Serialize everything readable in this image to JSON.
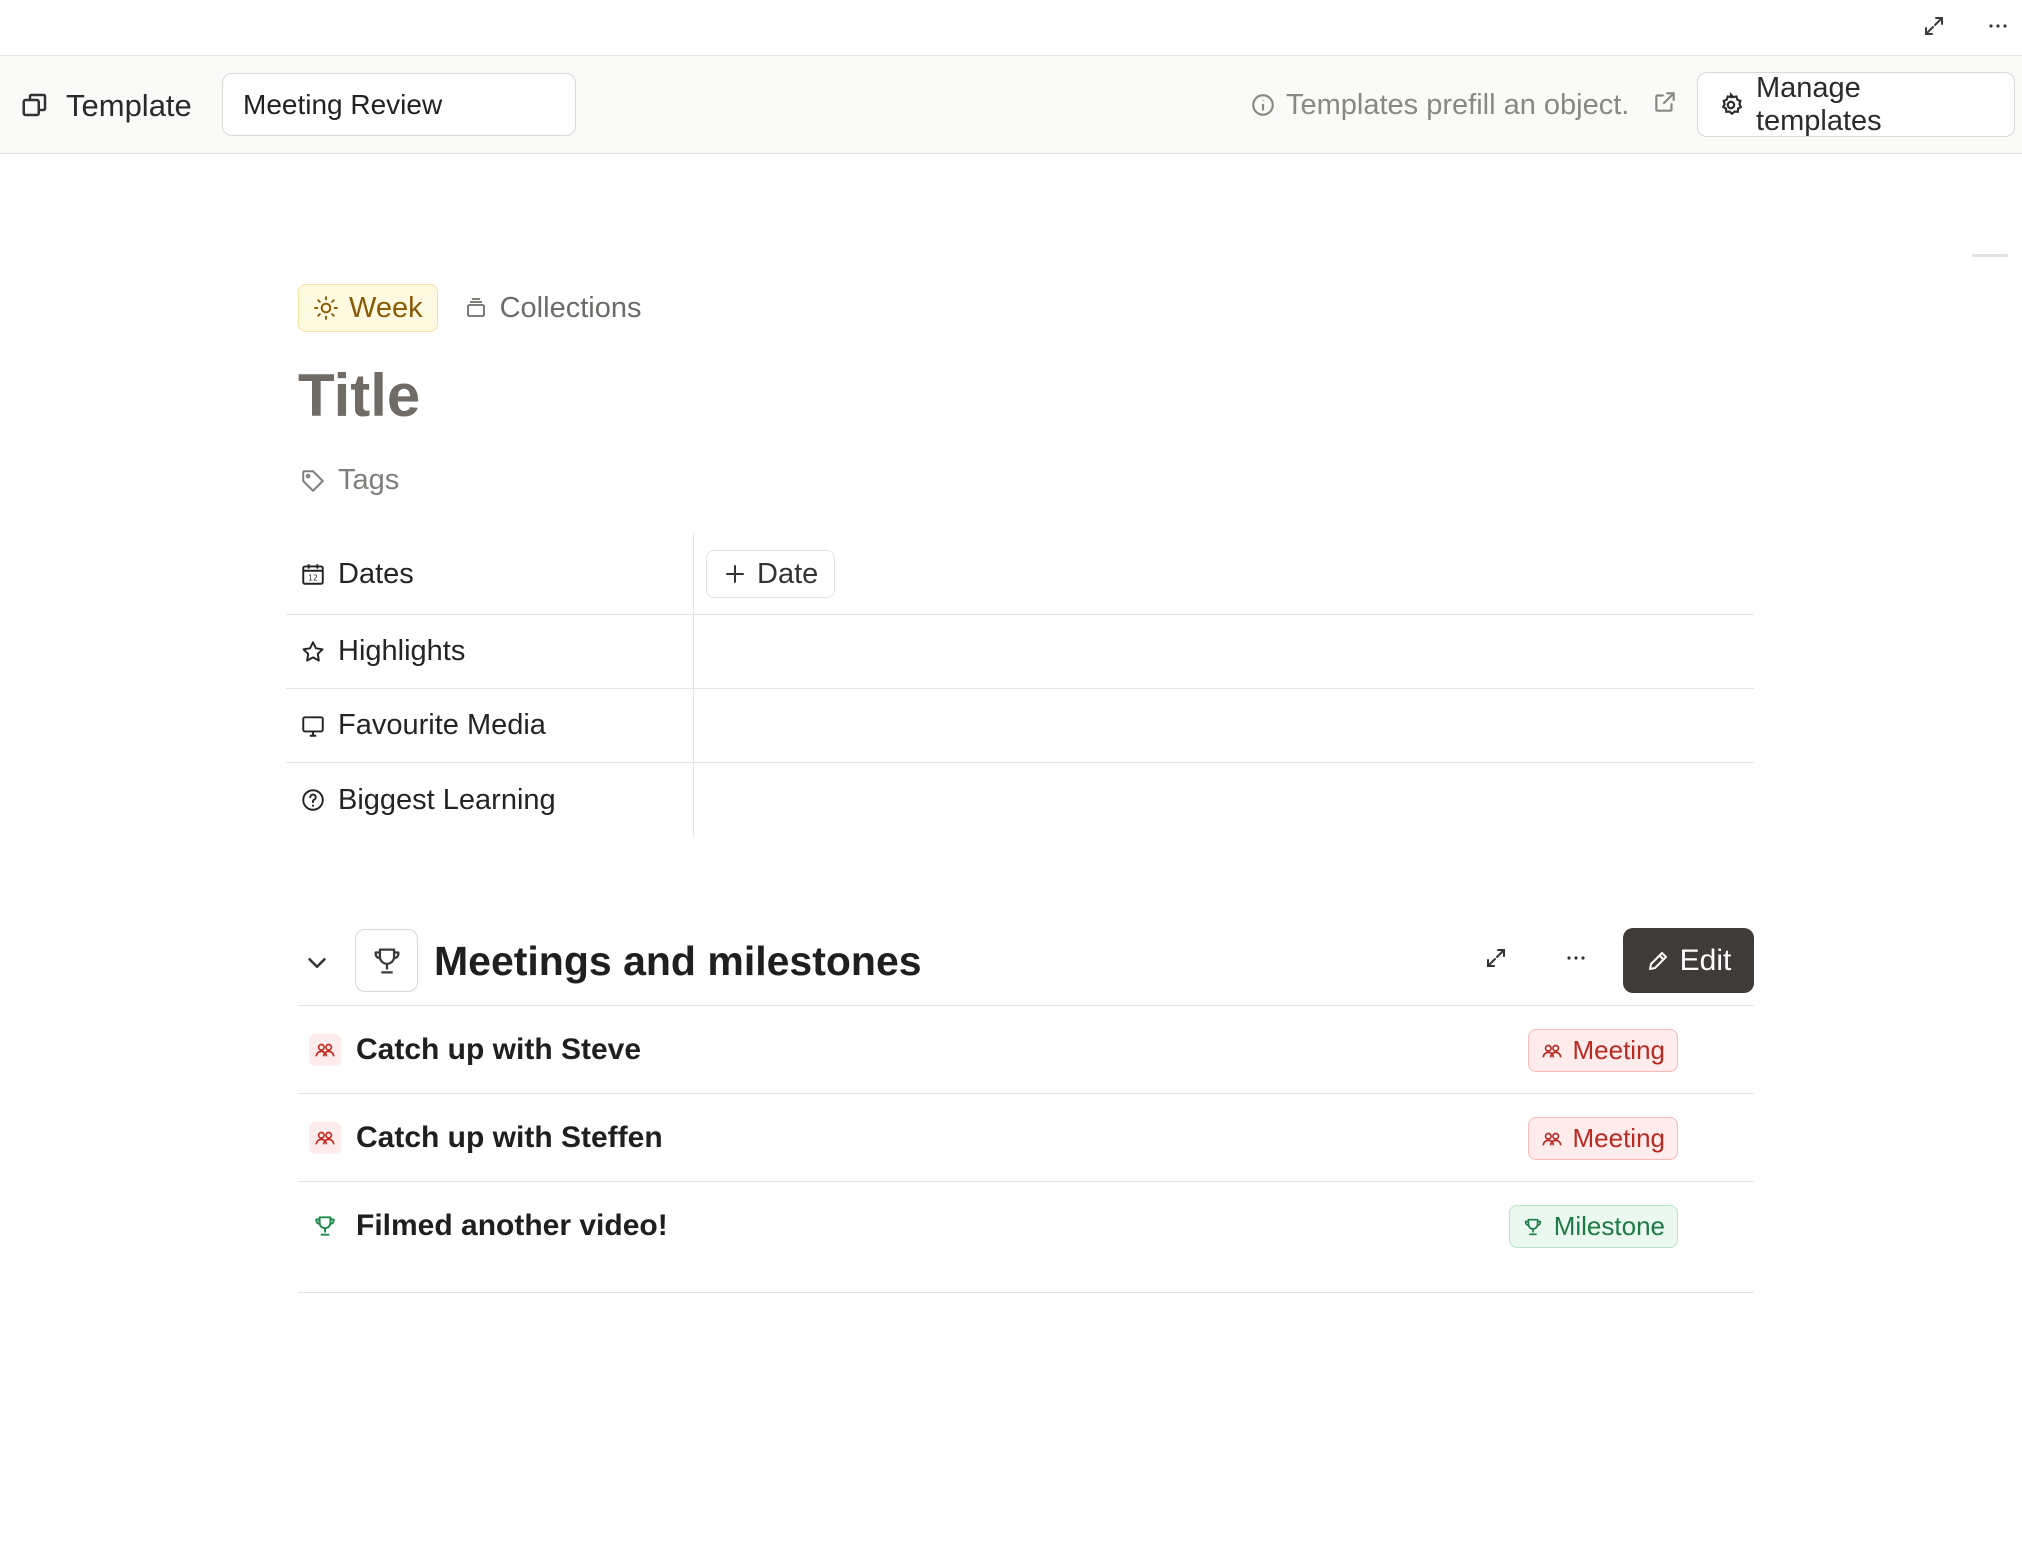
{
  "top_bar": {
    "expand_icon": "expand-icon",
    "more_icon": "more-icon"
  },
  "template_bar": {
    "label": "Template",
    "name_value": "Meeting Review",
    "info_text": "Templates prefill an object.",
    "manage_label": "Manage templates"
  },
  "object": {
    "type_label": "Week",
    "collections_label": "Collections",
    "title_placeholder": "Title",
    "tags_label": "Tags"
  },
  "properties": [
    {
      "label": "Dates",
      "icon": "calendar-icon",
      "value_button": "Date"
    },
    {
      "label": "Highlights",
      "icon": "star-icon"
    },
    {
      "label": "Favourite Media",
      "icon": "monitor-icon"
    },
    {
      "label": "Biggest Learning",
      "icon": "question-circle-icon"
    }
  ],
  "section": {
    "title": "Meetings and milestones",
    "edit_label": "Edit",
    "items": [
      {
        "name": "Catch up with Steve",
        "badge": "Meeting",
        "icon": "people-icon",
        "color": "#c22a21"
      },
      {
        "name": "Catch up with Steffen",
        "badge": "Meeting",
        "icon": "people-icon",
        "color": "#c22a21"
      },
      {
        "name": "Filmed another video!",
        "badge": "Milestone",
        "icon": "trophy-icon",
        "color": "#1e8a4a"
      }
    ]
  },
  "colors": {
    "week_chip": "#8a5a05",
    "meeting": "#b92b22",
    "milestone": "#1e7a45",
    "edit_button_bg": "#3e3b38"
  }
}
